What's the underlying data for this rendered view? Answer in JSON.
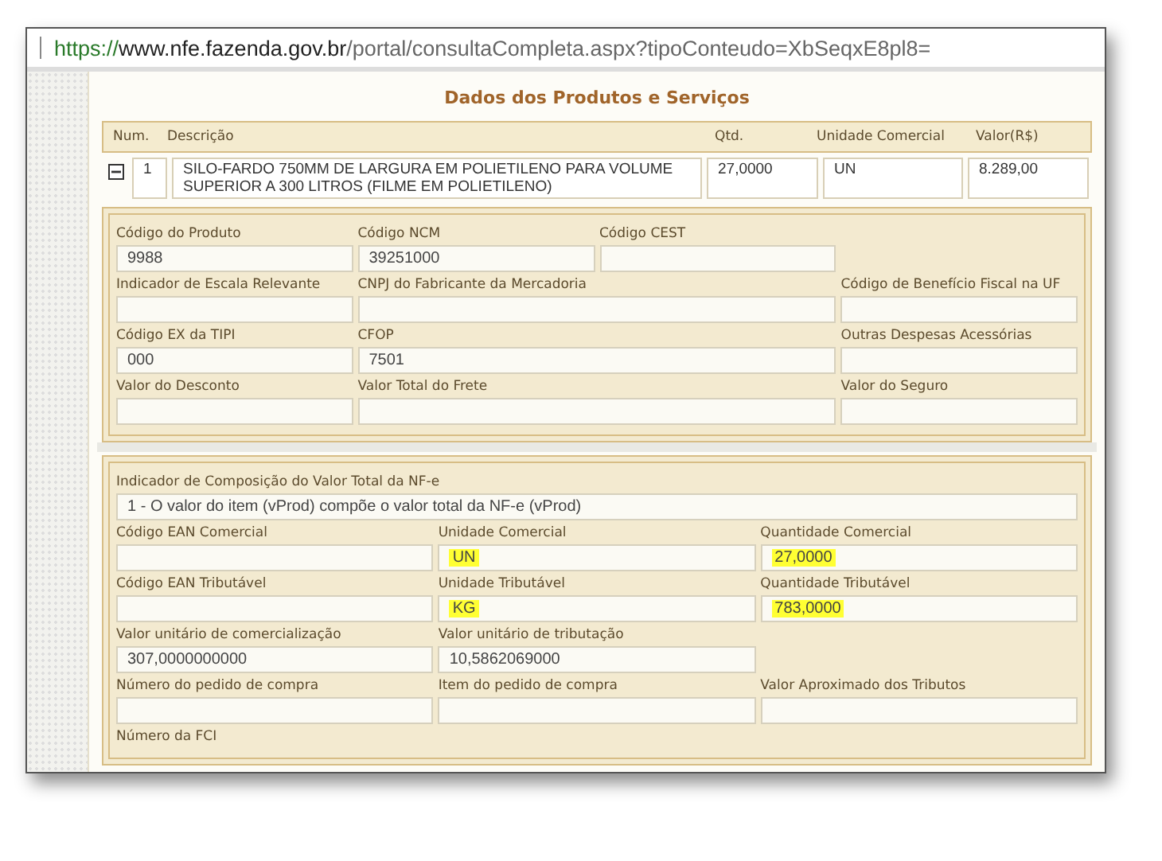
{
  "address_bar": {
    "scheme": "https://",
    "host": "www.nfe.fazenda.gov.br",
    "path": "/portal/consultaCompleta.aspx?tipoConteudo=XbSeqxE8pl8="
  },
  "section_title": "Dados dos Produtos e Serviços",
  "table": {
    "columns": [
      "Num.",
      "Descrição",
      "Qtd.",
      "Unidade Comercial",
      "Valor(R$)"
    ],
    "rows": [
      {
        "expanded": true,
        "cells": [
          "1",
          "SILO-FARDO 750MM DE LARGURA EM POLIETILENO PARA VOLUME SUPERIOR A 300 LITROS (FILME EM POLIETILENO)",
          "27,0000",
          "UN",
          "8.289,00"
        ]
      }
    ]
  },
  "details_1": {
    "rows": [
      [
        {
          "kind": "normal",
          "label": "Código do Produto",
          "value": "9988"
        },
        {
          "kind": "normal",
          "label": "Código NCM",
          "value": "39251000"
        },
        {
          "kind": "normal",
          "label": "Código CEST"
        }
      ],
      [
        {
          "kind": "normal",
          "label": "Indicador de Escala Relevante"
        },
        {
          "kind": "wide",
          "label": "CNPJ do Fabricante da Mercadoria"
        },
        {
          "kind": "normal",
          "label": "Código de Benefício Fiscal na UF"
        }
      ],
      [
        {
          "kind": "normal",
          "label": "Código EX da TIPI",
          "value": "000"
        },
        {
          "kind": "wide",
          "label": "CFOP",
          "value": "7501"
        },
        {
          "kind": "normal",
          "label": "Outras Despesas Acessórias"
        }
      ],
      [
        {
          "kind": "normal",
          "label": "Valor do Desconto"
        },
        {
          "kind": "wide",
          "label": "Valor Total do Frete"
        },
        {
          "kind": "normal",
          "label": "Valor do Seguro"
        }
      ]
    ]
  },
  "details_2": {
    "composition": {
      "label": "Indicador de Composição do Valor Total da NF-e",
      "value": "1 - O valor do item (vProd) compõe o valor total da NF-e (vProd)"
    },
    "rows": [
      [
        {
          "kind": "normal",
          "label": "Código EAN Comercial",
          "highlighted": false
        },
        {
          "kind": "normal",
          "label": "Unidade Comercial",
          "value": "UN",
          "highlighted": true
        },
        {
          "kind": "normal",
          "label": "Quantidade Comercial",
          "value": "27,0000",
          "highlighted": true
        }
      ],
      [
        {
          "kind": "normal",
          "label": "Código EAN Tributável",
          "highlighted": false
        },
        {
          "kind": "normal",
          "label": "Unidade Tributável",
          "value": "KG",
          "highlighted": true
        },
        {
          "kind": "normal",
          "label": "Quantidade Tributável",
          "value": "783,0000",
          "highlighted": true
        }
      ],
      [
        {
          "kind": "normal",
          "label": "Valor unitário de comercialização",
          "value": "307,0000000000",
          "highlighted": false
        },
        {
          "kind": "normal",
          "label": "Valor unitário de tributação",
          "value": "10,5862069000",
          "highlighted": false
        }
      ],
      [
        {
          "kind": "normal",
          "label": "Número do pedido de compra",
          "highlighted": false
        },
        {
          "kind": "normal",
          "label": "Item do pedido de compra",
          "highlighted": false
        },
        {
          "kind": "normal",
          "label": "Valor Aproximado dos Tributos",
          "highlighted": false
        }
      ],
      [
        {
          "kind": "label_only",
          "label": "Número da FCI"
        }
      ]
    ]
  }
}
